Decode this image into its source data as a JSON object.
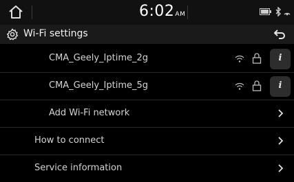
{
  "status_bar": {
    "time": "6:02",
    "ampm": "AM",
    "home_icon": "home-icon",
    "icons": [
      "battery-icon",
      "bluetooth-icon",
      "signal-icon"
    ]
  },
  "header": {
    "title": "Wi-Fi settings",
    "icon": "gear-icon",
    "back_icon": "back-arrow-icon"
  },
  "networks": [
    {
      "name": "CMA_Geely_Iptime_2g",
      "icons": [
        "wifi-icon",
        "lock-icon",
        "info-icon"
      ]
    },
    {
      "name": "CMA_Geely_Iptime_5g",
      "icons": [
        "wifi-icon",
        "lock-icon",
        "info-icon"
      ]
    }
  ],
  "add_network": {
    "label": "Add Wi-Fi network"
  },
  "menu": [
    {
      "label": "How to connect"
    },
    {
      "label": "Service information"
    }
  ],
  "info_glyph": "i",
  "colors": {
    "background": "#000000",
    "status_bar": "#111111",
    "header": "#1a1a1a",
    "text": "#d4d4d4",
    "divider": "#2a2a2a"
  }
}
